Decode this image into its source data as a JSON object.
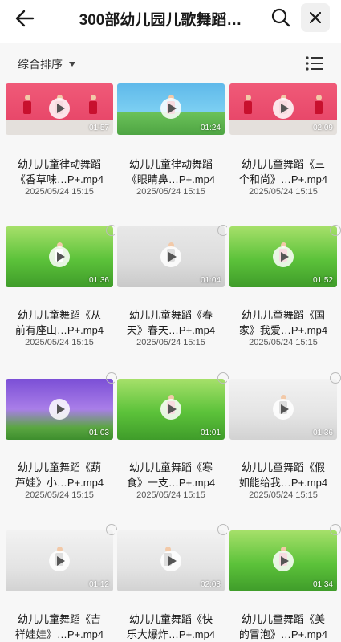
{
  "header": {
    "title": "300部幼儿园儿歌舞蹈…",
    "back_icon": "arrow-left-icon",
    "search_icon": "search-icon",
    "close_icon": "close-icon"
  },
  "toolbar": {
    "sort_label": "综合排序",
    "view_icon": "list-view-icon"
  },
  "colors": {
    "background": "#f7f7f7",
    "title": "#1a1a1a",
    "date": "#555555"
  },
  "videos": [
    {
      "name_line1": "幼儿儿童律动舞蹈",
      "name_line2": "《香草味…P+.mp4",
      "date": "2025/05/24 15:15",
      "duration": "01:57"
    },
    {
      "name_line1": "幼儿儿童律动舞蹈",
      "name_line2": "《眼睛鼻…P+.mp4",
      "date": "2025/05/24 15:15",
      "duration": "01:24"
    },
    {
      "name_line1": "幼儿儿童舞蹈《三",
      "name_line2": "个和尚》…P+.mp4",
      "date": "2025/05/24 15:15",
      "duration": "02:09"
    },
    {
      "name_line1": "幼儿儿童舞蹈《从",
      "name_line2": "前有座山…P+.mp4",
      "date": "2025/05/24 15:15",
      "duration": "01:36"
    },
    {
      "name_line1": "幼儿儿童舞蹈《春",
      "name_line2": "天》春天…P+.mp4",
      "date": "2025/05/24 15:15",
      "duration": "01:04"
    },
    {
      "name_line1": "幼儿儿童舞蹈《国",
      "name_line2": "家》我爱…P+.mp4",
      "date": "2025/05/24 15:15",
      "duration": "01:52"
    },
    {
      "name_line1": "幼儿儿童舞蹈《葫",
      "name_line2": "芦娃》小…P+.mp4",
      "date": "2025/05/24 15:15",
      "duration": "01:03"
    },
    {
      "name_line1": "幼儿儿童舞蹈《寒",
      "name_line2": "食》一支…P+.mp4",
      "date": "2025/05/24 15:15",
      "duration": "01:01"
    },
    {
      "name_line1": "幼儿儿童舞蹈《假",
      "name_line2": "如能给我…P+.mp4",
      "date": "2025/05/24 15:15",
      "duration": "01:36"
    },
    {
      "name_line1": "幼儿儿童舞蹈《吉",
      "name_line2": "祥娃娃》…P+.mp4",
      "date": "",
      "duration": "01:12"
    },
    {
      "name_line1": "幼儿儿童舞蹈《快",
      "name_line2": "乐大爆炸…P+.mp4",
      "date": "",
      "duration": "02:03"
    },
    {
      "name_line1": "幼儿儿童舞蹈《美",
      "name_line2": "的冒泡》…P+.mp4",
      "date": "",
      "duration": "01:34"
    }
  ]
}
